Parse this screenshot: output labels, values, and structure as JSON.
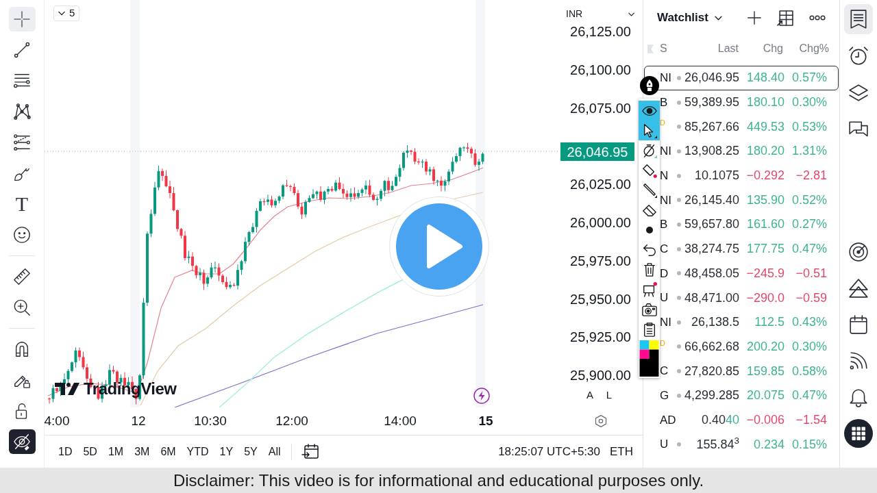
{
  "left_toolbar": {
    "tools": [
      {
        "kind": "crosshair",
        "selected": true
      },
      {
        "kind": "trend-line",
        "selected": false
      },
      {
        "kind": "fib",
        "selected": false
      },
      {
        "kind": "pattern",
        "selected": false
      },
      {
        "kind": "projection",
        "selected": false
      },
      {
        "kind": "brush",
        "selected": false
      },
      {
        "kind": "text",
        "label": "T",
        "selected": false
      },
      {
        "kind": "emoji",
        "selected": false
      }
    ],
    "utilities": [
      {
        "kind": "ruler"
      },
      {
        "kind": "zoom"
      }
    ],
    "toggles": [
      {
        "kind": "magnet",
        "on": false
      },
      {
        "kind": "lock-drawings",
        "on": false
      },
      {
        "kind": "lock",
        "on": false
      },
      {
        "kind": "hide-drawings",
        "on": true
      }
    ]
  },
  "chart": {
    "interval": "5",
    "currency": "INR",
    "price_labels": [
      "26,125.00",
      "26,100.00",
      "26,075.00",
      "26,025.00",
      "26,000.00",
      "25,975.00",
      "25,950.00",
      "25,925.00",
      "25,900.00"
    ],
    "last_price": "26,046.95",
    "logo_text": "TradingView",
    "scale_buttons": [
      "A",
      "L"
    ],
    "time_labels": [
      {
        "label": "4:00",
        "bold": false
      },
      {
        "label": "12",
        "bold": false
      },
      {
        "label": "10:30",
        "bold": false
      },
      {
        "label": "12:00",
        "bold": false
      },
      {
        "label": "14:00",
        "bold": false
      },
      {
        "label": "15",
        "bold": true
      }
    ]
  },
  "range_bar": {
    "ranges": [
      "1D",
      "5D",
      "1M",
      "3M",
      "6M",
      "YTD",
      "1Y",
      "5Y",
      "All"
    ],
    "time": "18:25:07 UTC+5:30",
    "session": "ETH"
  },
  "drawing_toolbar": {
    "tools": [
      {
        "kind": "eye",
        "selected": true
      },
      {
        "kind": "cursor",
        "selected": true
      },
      {
        "kind": "no-snap",
        "selected": false
      },
      {
        "kind": "highlighter",
        "selected": false
      },
      {
        "kind": "line",
        "selected": false
      },
      {
        "kind": "eraser",
        "selected": false
      },
      {
        "kind": "dot",
        "selected": false
      },
      {
        "kind": "undo",
        "selected": false
      },
      {
        "kind": "trash",
        "selected": false
      },
      {
        "kind": "easel",
        "selected": false
      },
      {
        "kind": "camera",
        "selected": false
      },
      {
        "kind": "clipboard",
        "selected": false
      },
      {
        "kind": "palette",
        "selected": false
      }
    ]
  },
  "watchlist": {
    "title": "Watchlist",
    "columns": [
      "S",
      "Last",
      "Chg",
      "Chg%"
    ],
    "rows": [
      {
        "symbol": "NI",
        "status_dot": true,
        "last": "26,046.95",
        "chg": "148.40",
        "chg_pct": "0.57%",
        "positive": true,
        "selected": true
      },
      {
        "symbol": "B",
        "status_dot": true,
        "last": "59,389.95",
        "chg": "180.10",
        "chg_pct": "0.30%",
        "positive": true,
        "selected": false
      },
      {
        "badge": "D",
        "status_dot": true,
        "last": "85,267.66",
        "chg": "449.53",
        "chg_pct": "0.53%",
        "positive": true,
        "selected": false
      },
      {
        "symbol": "NI",
        "status_dot": true,
        "last": "13,908.25",
        "chg": "180.20",
        "chg_pct": "1.31%",
        "positive": true,
        "selected": false
      },
      {
        "symbol": "N",
        "status_dot": true,
        "last": "10.1075",
        "chg": "−0.292",
        "chg_pct": "−2.81",
        "positive": false,
        "selected": false
      },
      {
        "symbol": "NI",
        "status_dot": true,
        "last": "26,145.40",
        "chg": "135.90",
        "chg_pct": "0.52%",
        "positive": true,
        "selected": false
      },
      {
        "symbol": "B",
        "status_dot": true,
        "last": "59,657.80",
        "chg": "161.60",
        "chg_pct": "0.27%",
        "positive": true,
        "selected": false
      },
      {
        "symbol": "C",
        "status_dot": true,
        "last": "38,274.75",
        "chg": "177.75",
        "chg_pct": "0.47%",
        "positive": true,
        "selected": false
      },
      {
        "symbol": "D",
        "status_dot": true,
        "last": "48,458.05",
        "chg": "−245.9",
        "chg_pct": "−0.51",
        "positive": false,
        "selected": false
      },
      {
        "symbol": "U",
        "status_dot": true,
        "last": "48,471.00",
        "chg": "−290.0",
        "chg_pct": "−0.59",
        "positive": false,
        "selected": false
      },
      {
        "symbol": "NI",
        "status_dot": true,
        "last": "26,138.5",
        "chg": "112.5",
        "chg_pct": "0.43%",
        "positive": true,
        "selected": false
      },
      {
        "badge": "D",
        "status_dot": true,
        "last": "66,662.68",
        "chg": "200.20",
        "chg_pct": "0.30%",
        "positive": true,
        "selected": false
      },
      {
        "symbol": "C",
        "status_dot": true,
        "last": "27,820.85",
        "chg": "159.85",
        "chg_pct": "0.58%",
        "positive": true,
        "selected": false
      },
      {
        "symbol": "G",
        "status_dot": true,
        "last": "4,299.285",
        "chg": "20.075",
        "chg_pct": "0.47%",
        "positive": true,
        "selected": false
      },
      {
        "symbol": "AD",
        "status_dot": false,
        "last": "0.40",
        "last_tail": "40",
        "chg": "−0.006",
        "chg_pct": "−1.54",
        "positive": false,
        "selected": false
      },
      {
        "symbol": "U",
        "status_dot": true,
        "last": "155.84$^{3}$",
        "chg": "0.234",
        "chg_pct": "0.15%",
        "positive": true,
        "selected": false
      }
    ]
  },
  "right_sidebar": {
    "panels": [
      {
        "kind": "watchlist",
        "selected": true
      },
      {
        "kind": "alerts",
        "selected": false
      },
      {
        "kind": "object-tree",
        "selected": false
      },
      {
        "kind": "chats",
        "selected": false
      }
    ],
    "tools": [
      {
        "kind": "screeners",
        "selected": false
      },
      {
        "kind": "ideas",
        "selected": false
      },
      {
        "kind": "calendar",
        "selected": false
      },
      {
        "kind": "news",
        "selected": false
      },
      {
        "kind": "notifications",
        "selected": false
      },
      {
        "kind": "products",
        "selected": false
      }
    ]
  },
  "disclaimer": "Disclaimer: This video is for informational and educational purposes only."
}
